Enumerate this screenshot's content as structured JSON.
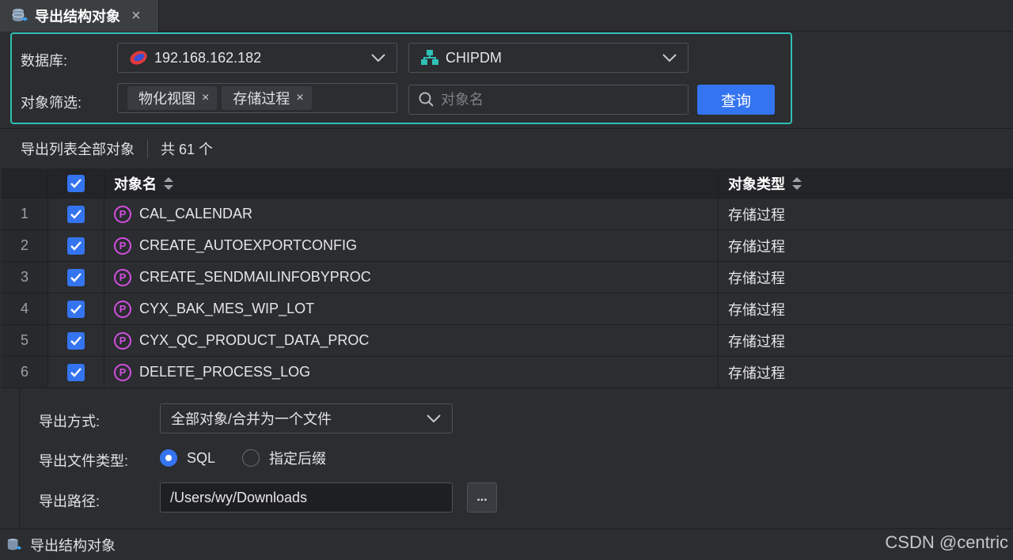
{
  "tab": {
    "title": "导出结构对象",
    "close": "×"
  },
  "filter": {
    "db_label": "数据库:",
    "db_value": "192.168.162.182",
    "schema_value": "CHIPDM",
    "obj_filter_label": "对象筛选:",
    "chips": [
      "物化视图",
      "存储过程"
    ],
    "chip_close": "×",
    "search_placeholder": "对象名",
    "query_button": "查询"
  },
  "summary": {
    "export_all": "导出列表全部对象",
    "total": "共 61 个"
  },
  "table": {
    "headers": {
      "name": "对象名",
      "type": "对象类型"
    },
    "rows": [
      {
        "idx": "1",
        "name": "CAL_CALENDAR",
        "type": "存储过程"
      },
      {
        "idx": "2",
        "name": "CREATE_AUTOEXPORTCONFIG",
        "type": "存储过程"
      },
      {
        "idx": "3",
        "name": "CREATE_SENDMAILINFOBYPROC",
        "type": "存储过程"
      },
      {
        "idx": "4",
        "name": "CYX_BAK_MES_WIP_LOT",
        "type": "存储过程"
      },
      {
        "idx": "5",
        "name": "CYX_QC_PRODUCT_DATA_PROC",
        "type": "存储过程"
      },
      {
        "idx": "6",
        "name": "DELETE_PROCESS_LOG",
        "type": "存储过程"
      }
    ],
    "proc_icon_letter": "P"
  },
  "options": {
    "mode_label": "导出方式:",
    "mode_value": "全部对象/合并为一个文件",
    "filetype_label": "导出文件类型:",
    "filetype_sql": "SQL",
    "filetype_custom": "指定后缀",
    "path_label": "导出路径:",
    "path_value": "/Users/wy/Downloads",
    "browse_label": "..."
  },
  "status": {
    "text": "导出结构对象",
    "watermark": "CSDN @centric"
  },
  "colors": {
    "accent": "#3574f0",
    "panel_border": "#2fc0b5",
    "proc_icon": "#d24fe0"
  }
}
